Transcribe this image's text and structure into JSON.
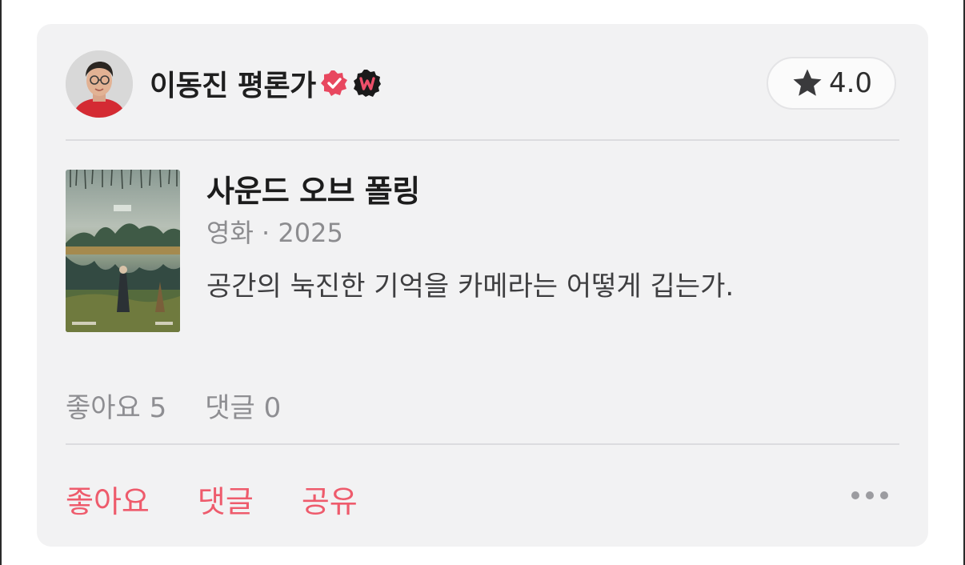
{
  "review": {
    "author": "이동진 평론가",
    "rating": "4.0",
    "icons": {
      "verified": "verified-check-icon",
      "badge": "watcha-w-badge-icon",
      "star": "star-icon",
      "more": "more-horizontal-icon"
    },
    "colors": {
      "accent": "#ee5b6c",
      "verified": "#e8475f",
      "badge_bg": "#1a1a1a"
    }
  },
  "content": {
    "title": "사운드 오브 폴링",
    "meta": "영화 · 2025",
    "comment": "공간의 눅진한 기억을 카메라는 어떻게 깁는가."
  },
  "stats": {
    "likes": "좋아요 5",
    "comments": "댓글 0"
  },
  "actions": {
    "like": "좋아요",
    "comment": "댓글",
    "share": "공유"
  }
}
